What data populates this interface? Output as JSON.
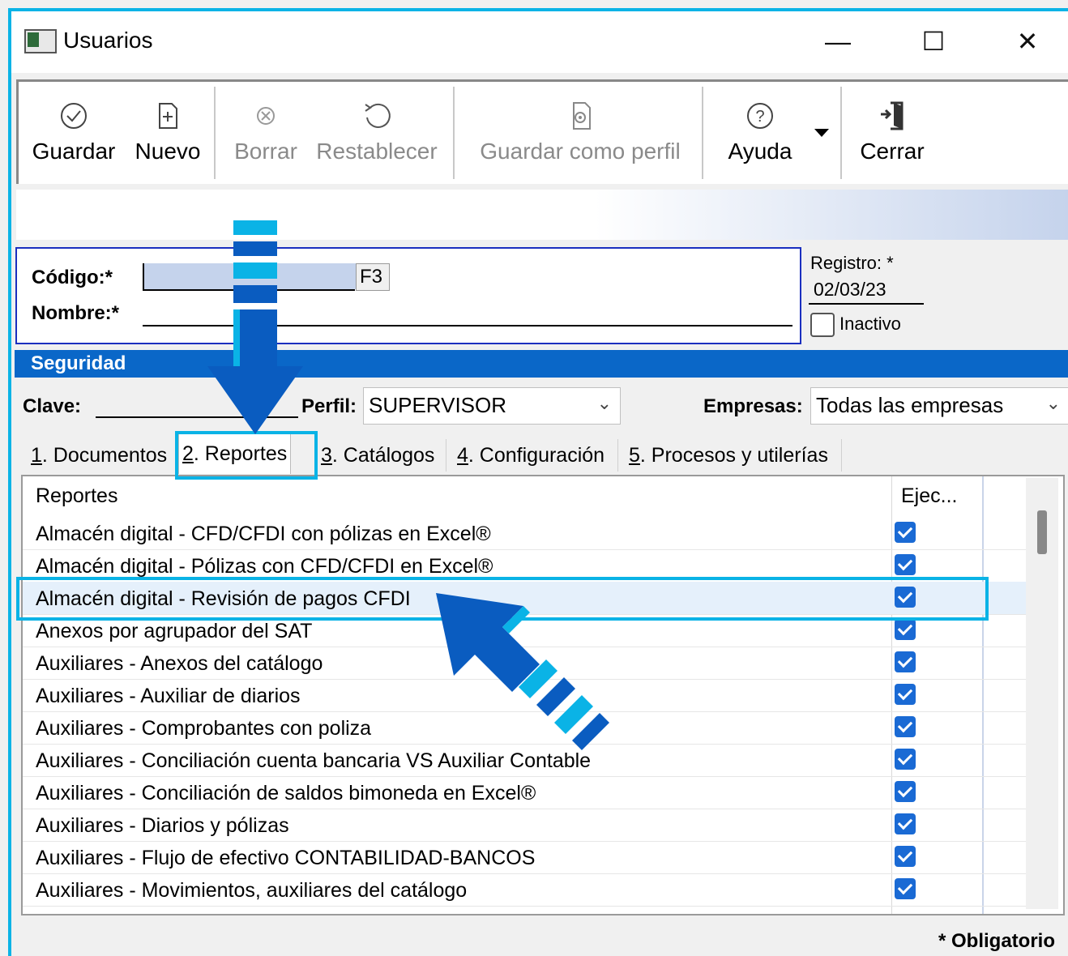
{
  "window": {
    "title": "Usuarios",
    "minimize": "—",
    "maximize": "☐",
    "close": "✕"
  },
  "toolbar": {
    "guardar": "Guardar",
    "nuevo": "Nuevo",
    "borrar": "Borrar",
    "restablecer": "Restablecer",
    "guardar_perfil": "Guardar como perfil",
    "ayuda": "Ayuda",
    "cerrar": "Cerrar"
  },
  "header": {
    "codigo_label": "Código:*",
    "codigo_value": "",
    "codigo_hotkey": "F3",
    "nombre_label": "Nombre:*",
    "nombre_value": "",
    "registro_label": "Registro: *",
    "registro_value": "02/03/23",
    "inactivo_label": "Inactivo"
  },
  "security": {
    "title": "Seguridad",
    "clave_label": "Clave:",
    "clave_value": "",
    "perfil_label": "Perfil:",
    "perfil_value": "SUPERVISOR",
    "empresas_label": "Empresas:",
    "empresas_value": "Todas las empresas"
  },
  "tabs": [
    {
      "num": "1",
      "label": ". Documentos"
    },
    {
      "num": "2",
      "label": ". Reportes"
    },
    {
      "num": "3",
      "label": ". Catálogos"
    },
    {
      "num": "4",
      "label": ". Configuración"
    },
    {
      "num": "5",
      "label": ". Procesos y utilerías"
    }
  ],
  "grid": {
    "col_name": "Reportes",
    "col_exec": "Ejec...",
    "rows": [
      "Almacén digital - CFD/CFDI con pólizas en Excel®",
      "Almacén digital - Pólizas con CFD/CFDI en Excel®",
      "Almacén digital - Revisión de pagos CFDI",
      "Anexos por agrupador del SAT",
      "Auxiliares - Anexos del catálogo",
      "Auxiliares - Auxiliar de diarios",
      "Auxiliares - Comprobantes con poliza",
      "Auxiliares - Conciliación cuenta bancaria VS Auxiliar Contable",
      "Auxiliares - Conciliación de saldos bimoneda en Excel®",
      "Auxiliares - Diarios y pólizas",
      "Auxiliares - Flujo de efectivo CONTABILIDAD-BANCOS",
      "Auxiliares - Movimientos, auxiliares del catálogo"
    ]
  },
  "footer": {
    "obligatorio": "* Obligatorio"
  },
  "colors": {
    "accent": "#0ab3e6",
    "header_bar": "#0a67c8",
    "arrow_dark": "#0a5cc0",
    "checkbox": "#1a6ad4"
  }
}
